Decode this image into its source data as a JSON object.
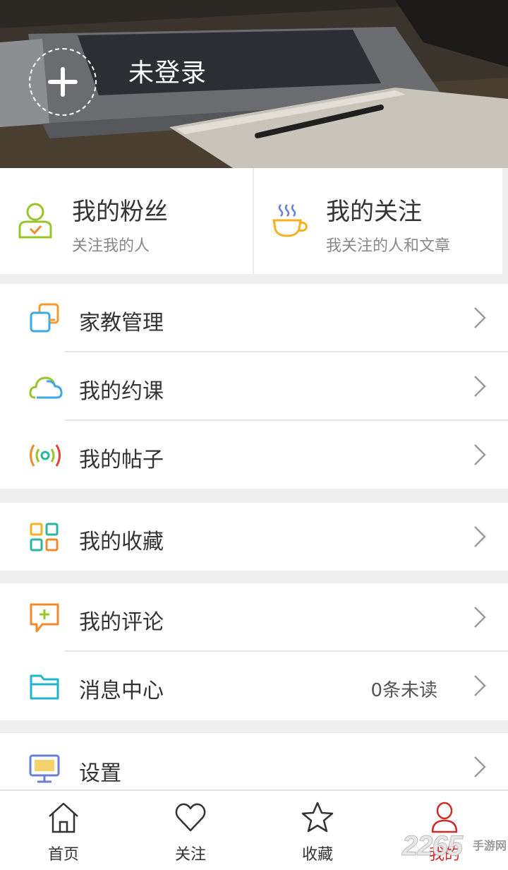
{
  "header": {
    "login_status": "未登录",
    "add_icon": "plus-icon"
  },
  "cards": {
    "fans": {
      "title": "我的粉丝",
      "subtitle": "关注我的人",
      "icon": "person-icon"
    },
    "following": {
      "title": "我的关注",
      "subtitle": "我关注的人和文章",
      "icon": "coffee-cup-icon"
    }
  },
  "menu": {
    "tutor": {
      "label": "家教管理",
      "icon": "copy-squares-icon"
    },
    "courses": {
      "label": "我的约课",
      "icon": "cloud-icon"
    },
    "posts": {
      "label": "我的帖子",
      "icon": "broadcast-icon"
    },
    "favorites": {
      "label": "我的收藏",
      "icon": "grid-icon"
    },
    "comments": {
      "label": "我的评论",
      "icon": "comment-plus-icon"
    },
    "messages": {
      "label": "消息中心",
      "value": "0条未读",
      "icon": "folder-icon"
    },
    "settings": {
      "label": "设置",
      "icon": "monitor-icon"
    }
  },
  "tabbar": {
    "home": {
      "label": "首页",
      "icon": "home-icon"
    },
    "follow": {
      "label": "关注",
      "icon": "heart-icon"
    },
    "collect": {
      "label": "收藏",
      "icon": "star-icon"
    },
    "mine": {
      "label": "我的",
      "icon": "user-icon",
      "active": true
    }
  },
  "watermark": {
    "number": "2265",
    "text": "手游网"
  },
  "colors": {
    "active_tab": "#d12a2a",
    "background": "#eeeeee"
  }
}
